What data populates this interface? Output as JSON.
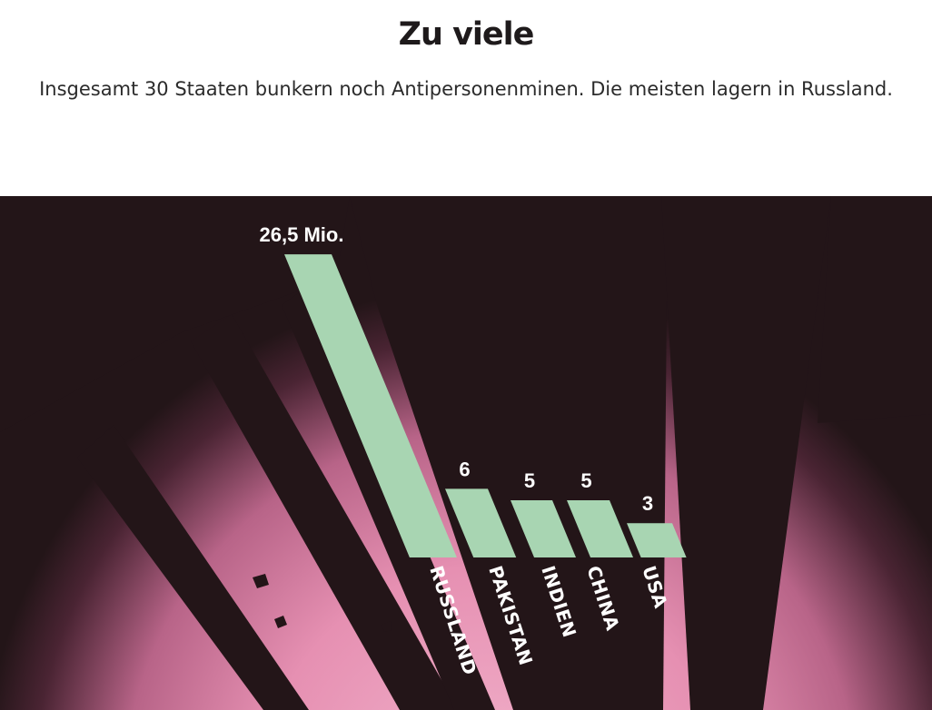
{
  "header": {
    "title": "Zu viele",
    "subtitle": "Insgesamt 30 Staaten bunkern noch Antipersonenminen. Die meisten lagern in Russland."
  },
  "colors": {
    "background": "#231518",
    "bars": "#a8d5b2",
    "pink_glow": "#e690b2",
    "label_text": "#ffffff"
  },
  "chart_data": {
    "type": "bar",
    "title": "Zu viele",
    "subtitle": "Insgesamt 30 Staaten bunkern noch Antipersonenminen. Die meisten lagern in Russland.",
    "unit": "Mio.",
    "categories": [
      "RUSSLAND",
      "PAKISTAN",
      "INDIEN",
      "CHINA",
      "USA"
    ],
    "values": [
      26.5,
      6,
      5,
      5,
      3
    ],
    "value_labels": [
      "26,5 Mio.",
      "6",
      "5",
      "5",
      "3"
    ],
    "xlabel": "",
    "ylabel": "",
    "grid": false,
    "legend": "none"
  }
}
